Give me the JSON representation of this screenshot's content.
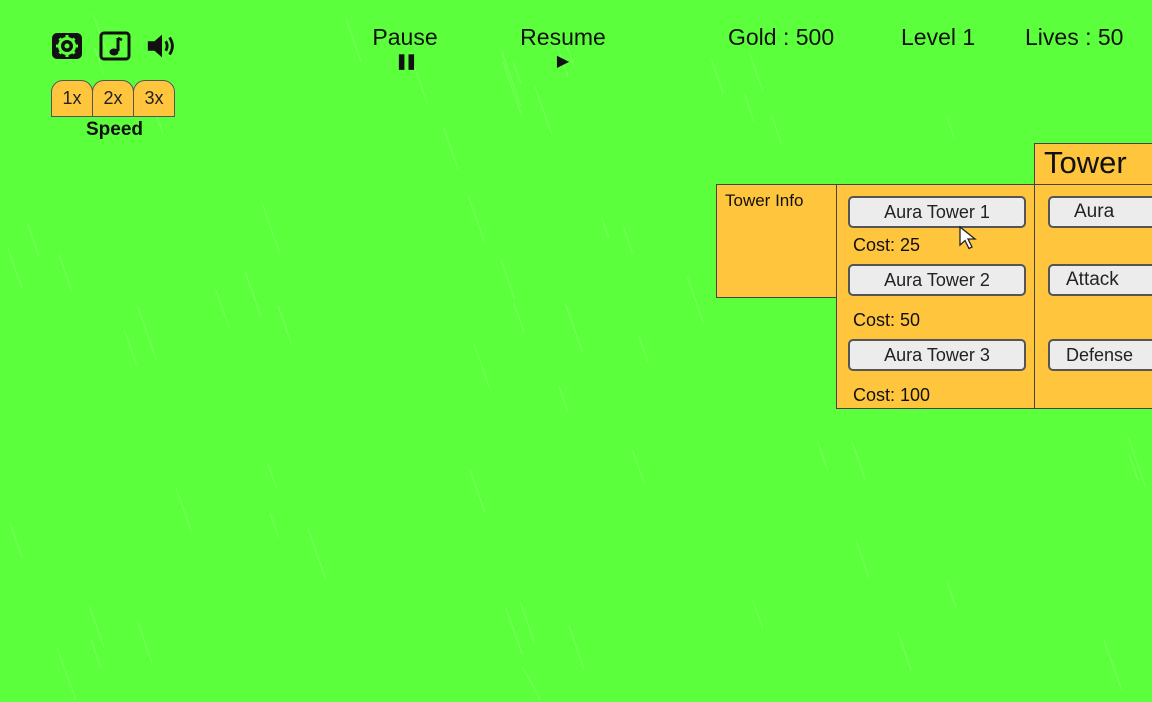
{
  "theme": {
    "background": "#5cff3c",
    "panel": "#ffc53d",
    "button": "#ececec"
  },
  "toolbar": {
    "settings_icon": "gear-icon",
    "music_icon": "music-note-icon",
    "sound_icon": "speaker-icon"
  },
  "speed": {
    "options": [
      "1x",
      "2x",
      "3x"
    ],
    "label": "Speed"
  },
  "controls": {
    "pause_label": "Pause",
    "pause_symbol": "❚❚",
    "resume_label": "Resume",
    "resume_symbol": "▶"
  },
  "stats": {
    "gold": "Gold : 500",
    "level": "Level 1",
    "lives": "Lives : 50"
  },
  "tower_info": {
    "title": "Tower Info"
  },
  "tower_shop": {
    "items": [
      {
        "name": "Aura Tower 1",
        "cost": "Cost: 25"
      },
      {
        "name": "Aura Tower 2",
        "cost": "Cost: 50"
      },
      {
        "name": "Aura Tower 3",
        "cost": "Cost: 100"
      }
    ]
  },
  "tower_categories": {
    "title": "Tower",
    "items": [
      "Aura",
      "Attack",
      "Defense"
    ]
  }
}
